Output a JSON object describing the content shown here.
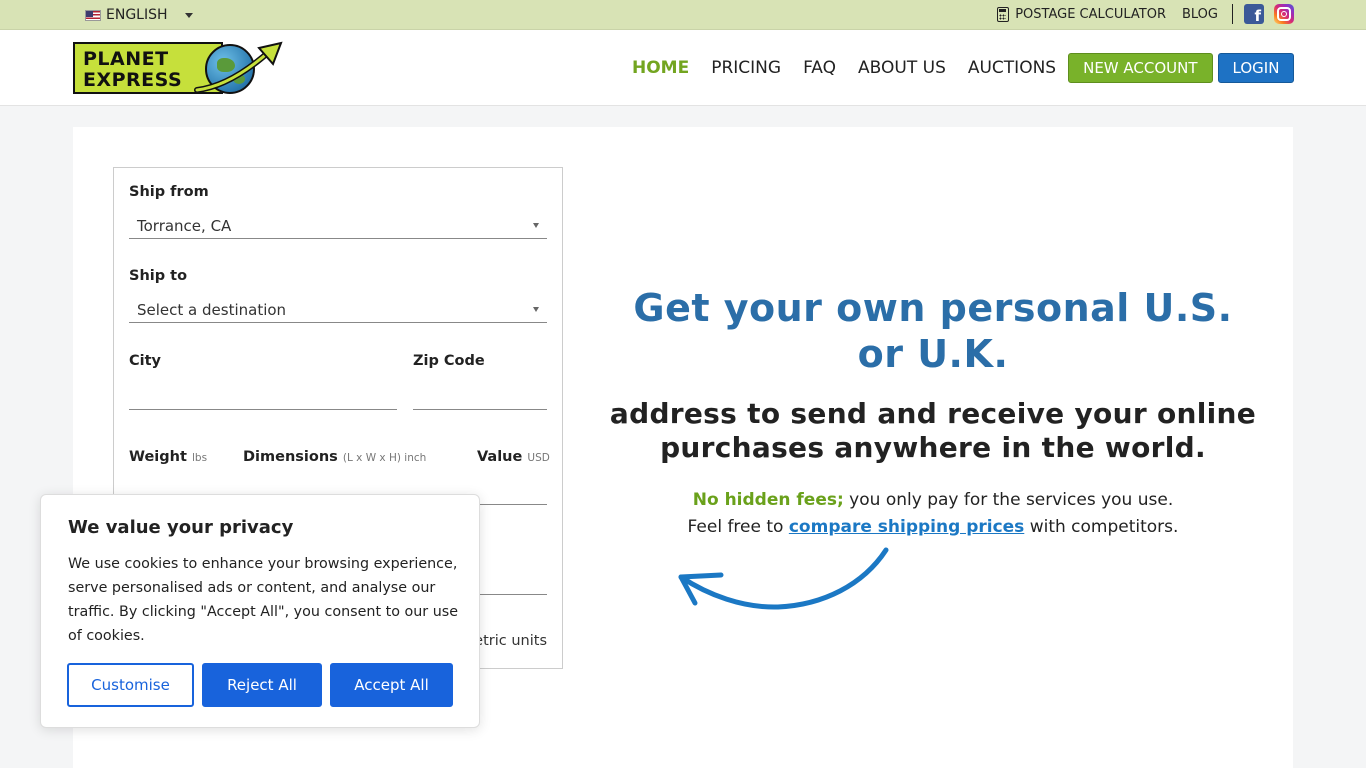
{
  "topbar": {
    "language": "ENGLISH",
    "postage_calculator": "POSTAGE CALCULATOR",
    "blog": "BLOG"
  },
  "header": {
    "logo_line1": "PLANET",
    "logo_line2": "EXPRESS",
    "nav": [
      "HOME",
      "PRICING",
      "FAQ",
      "ABOUT US",
      "AUCTIONS"
    ],
    "new_account": "NEW ACCOUNT",
    "login": "LOGIN"
  },
  "form": {
    "ship_from_label": "Ship from",
    "ship_from_value": "Torrance, CA",
    "ship_to_label": "Ship to",
    "ship_to_value": "Select a destination",
    "city_label": "City",
    "zip_label": "Zip Code",
    "weight_label": "Weight",
    "weight_unit": "lbs",
    "dimensions_label": "Dimensions",
    "dimensions_unit": "(L x W x H) inch",
    "value_label": "Value",
    "value_unit": "USD",
    "metric_text": "etric units"
  },
  "hero": {
    "title": "Get your own personal U.S. or U.K.",
    "subtitle": "address to send and receive your online purchases anywhere in the world.",
    "no_fees": "No hidden fees;",
    "line1_rest": " you only pay for the services you use.",
    "line2_start": "Feel free to ",
    "compare_link": "compare shipping prices",
    "line2_end": " with competitors."
  },
  "cookie": {
    "title": "We value your privacy",
    "text": "We use cookies to enhance your browsing experience, serve personalised ads or content, and analyse our traffic. By clicking \"Accept All\", you consent to our use of cookies.",
    "customise": "Customise",
    "reject": "Reject All",
    "accept": "Accept All"
  },
  "colors": {
    "accent_green": "#79b22a",
    "accent_blue": "#1e72c4",
    "hero_blue": "#2b6ea8",
    "cookie_blue": "#1863dc"
  }
}
